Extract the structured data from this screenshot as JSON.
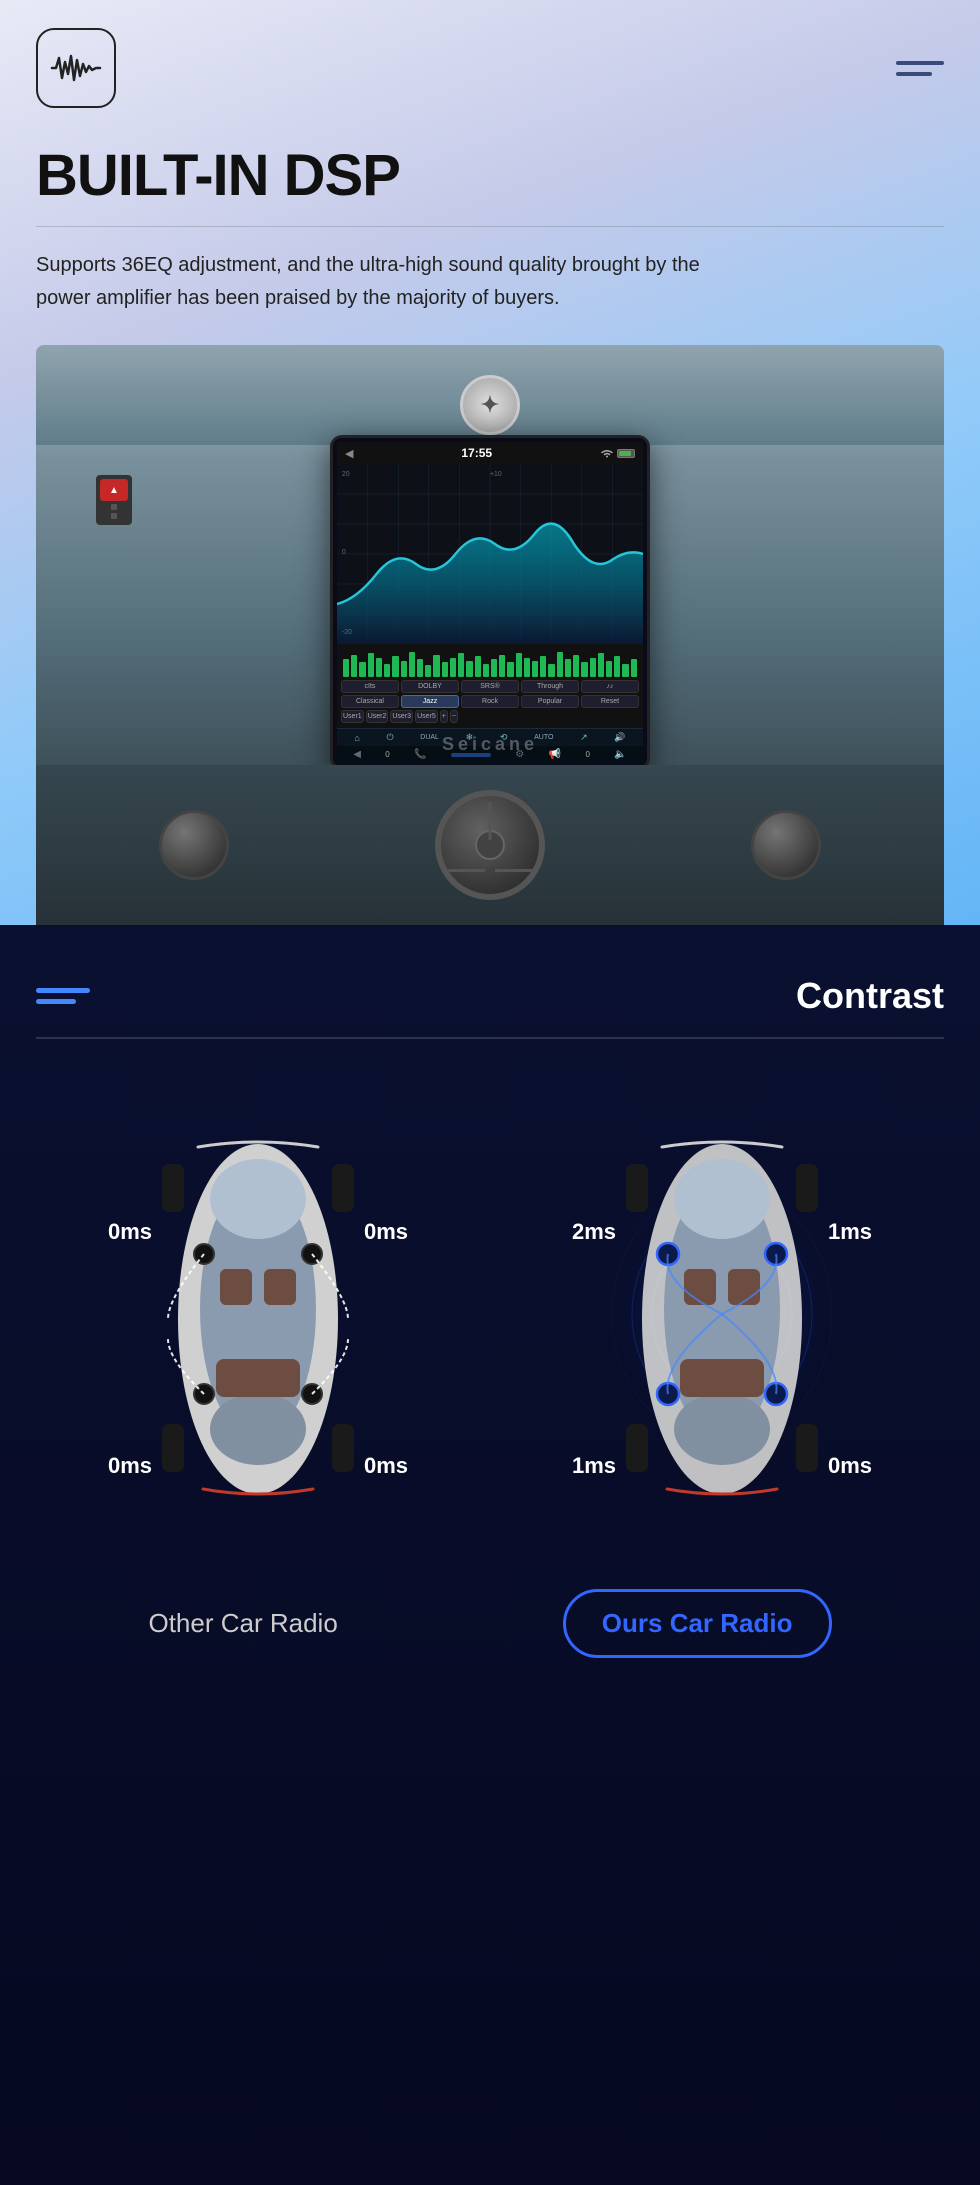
{
  "header": {
    "logo_icon": "🎵",
    "page_title": "BUILT-IN DSP",
    "subtitle": "Supports 36EQ adjustment, and the ultra-high sound quality brought by the power amplifier has been praised by the majority of buyers.",
    "divider": true
  },
  "screen": {
    "time": "17:55",
    "eq_label": "EQ Display",
    "presets": [
      "cIts",
      "DOLBY",
      "SRS®",
      "Through",
      "♪♪"
    ],
    "modes": [
      "Classical",
      "Jazz",
      "Rock",
      "Popular",
      "Reset"
    ],
    "users": [
      "User1",
      "User2",
      "User3",
      "User5",
      "+",
      "-"
    ]
  },
  "contrast": {
    "title": "Contrast",
    "icon": "contrast-icon",
    "divider": true
  },
  "other_car": {
    "label": "Other Car Radio",
    "ms_labels": {
      "top_left": "0ms",
      "top_right": "0ms",
      "bottom_left": "0ms",
      "bottom_right": "0ms"
    }
  },
  "our_car": {
    "label": "Ours Car Radio",
    "ms_labels": {
      "top_left": "2ms",
      "top_right": "1ms",
      "bottom_left": "1ms",
      "bottom_right": "0ms"
    }
  },
  "watermark": "Seicane"
}
